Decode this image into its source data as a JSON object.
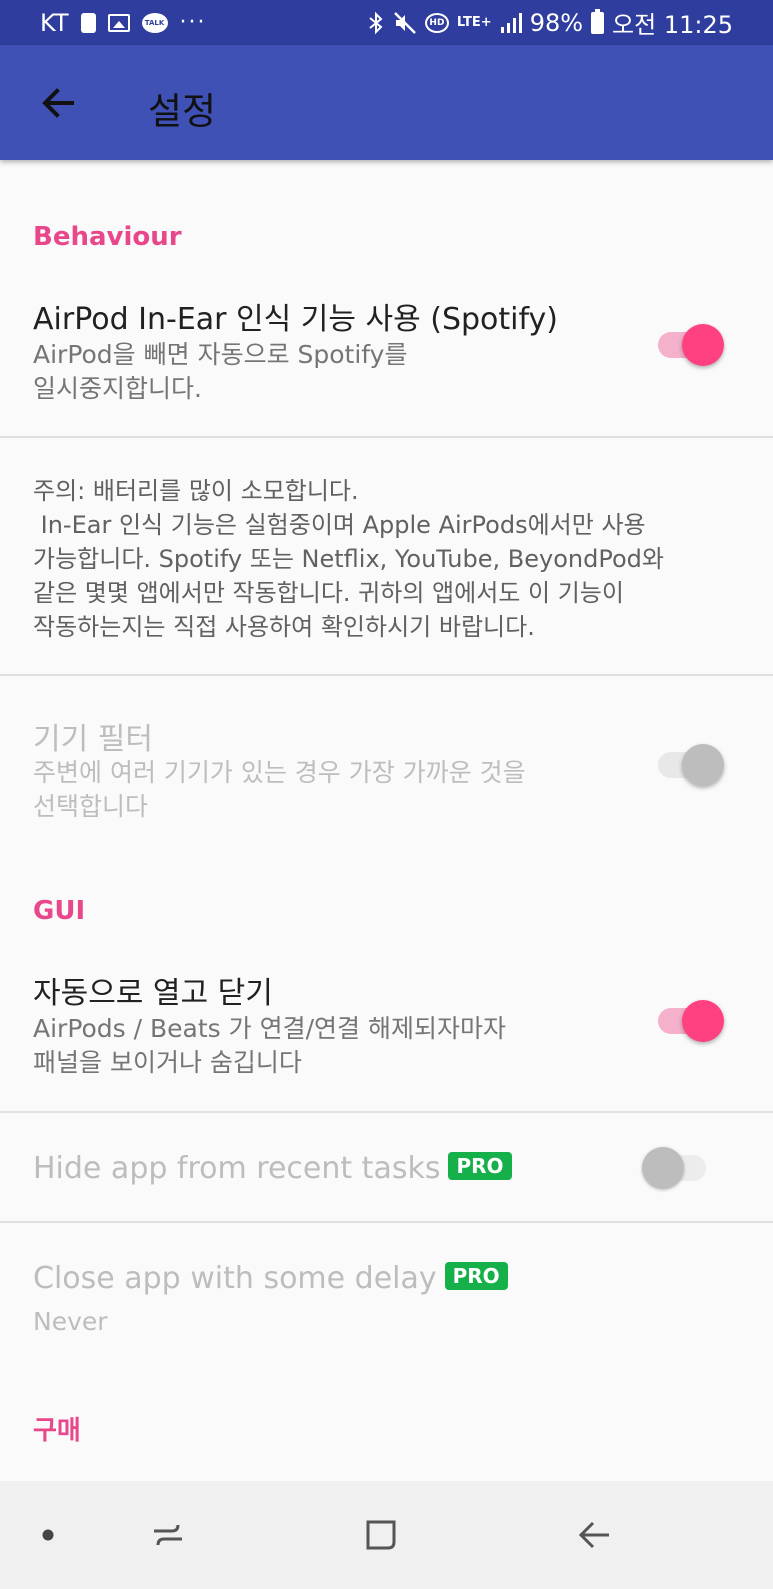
{
  "status_bar": {
    "carrier": "KT",
    "dots": "···",
    "talk_label": "TALK",
    "hd_label": "HD",
    "lte_label": "LTE+",
    "battery": "98%",
    "time": "오전 11:25",
    "icons": [
      "notification-square-icon",
      "gallery-icon",
      "kakaotalk-icon",
      "more-dots-icon",
      "bluetooth-icon",
      "mute-icon",
      "hd-voice-icon",
      "lte-icon",
      "signal-icon",
      "battery-icon"
    ]
  },
  "app_bar": {
    "title": "설정",
    "back_icon": "back-arrow-icon",
    "color": "#3f51b5"
  },
  "categories": {
    "behaviour": "Behaviour",
    "gui": "GUI",
    "purchase": "구매"
  },
  "prefs": {
    "in_ear": {
      "title": "AirPod In-Ear 인식 기능 사용 (Spotify)",
      "summary_line1": "AirPod을 빼면 자동으로 Spotify를",
      "summary_line2": "일시중지합니다.",
      "checked": true
    },
    "note": {
      "line1": "주의: 배터리를 많이 소모합니다.",
      "line2": " In-Ear 인식 기능은 실험중이며 Apple AirPods에서만 사용",
      "line3": "가능합니다. Spotify 또는 Netflix, YouTube, BeyondPod와",
      "line4": "같은 몇몇 앱에서만 작동합니다. 귀하의 앱에서도 이 기능이",
      "line5": "작동하는지는 직접 사용하여 확인하시기 바랍니다."
    },
    "device_filter": {
      "title": "기기 필터",
      "summary_line1": "주변에 여러 기기가 있는 경우 가장 가까운 것을",
      "summary_line2": "선택합니다",
      "checked": true,
      "enabled": false
    },
    "auto_open_close": {
      "title": "자동으로 열고 닫기",
      "summary_line1": "AirPods / Beats 가 연결/연결 해제되자마자",
      "summary_line2": "패널을 보이거나 숨깁니다",
      "checked": true
    },
    "hide_recent": {
      "title": "Hide app from recent tasks",
      "badge": "PRO",
      "checked": false,
      "enabled": false
    },
    "close_delay": {
      "title": "Close app with some delay",
      "badge": "PRO",
      "value": "Never",
      "enabled": false
    }
  },
  "colors": {
    "accent": "#ff4081",
    "category": "#e8478b",
    "pro_badge": "#16b04a",
    "status_bar": "#2f3e9e"
  },
  "nav_bar": {
    "icons": [
      "dot-icon",
      "recent-apps-icon",
      "home-icon",
      "back-icon"
    ]
  }
}
